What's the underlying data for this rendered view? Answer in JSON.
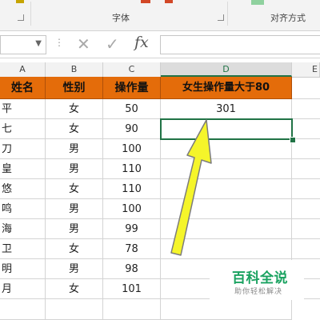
{
  "ribbon": {
    "font_group_label": "字体",
    "align_group_label": "对齐方式"
  },
  "formula_bar": {
    "namebox_value": "",
    "cancel_symbol": "✕",
    "enter_symbol": "✓",
    "fx_label": "fx",
    "formula_value": ""
  },
  "columns": [
    "A",
    "B",
    "C",
    "D",
    "E"
  ],
  "table": {
    "headers": [
      "姓名",
      "性别",
      "操作量",
      "女生操作量大于80"
    ],
    "rows": [
      {
        "name": "平",
        "gender": "女",
        "ops": "50",
        "d": "301"
      },
      {
        "name": "七",
        "gender": "女",
        "ops": "90",
        "d": ""
      },
      {
        "name": "刀",
        "gender": "男",
        "ops": "100",
        "d": ""
      },
      {
        "name": "皇",
        "gender": "男",
        "ops": "110",
        "d": ""
      },
      {
        "name": "悠",
        "gender": "女",
        "ops": "110",
        "d": ""
      },
      {
        "name": "鸣",
        "gender": "男",
        "ops": "100",
        "d": ""
      },
      {
        "name": "海",
        "gender": "男",
        "ops": "99",
        "d": ""
      },
      {
        "name": "卫",
        "gender": "女",
        "ops": "78",
        "d": ""
      },
      {
        "name": "明",
        "gender": "男",
        "ops": "98",
        "d": ""
      },
      {
        "name": "月",
        "gender": "女",
        "ops": "101",
        "d": ""
      }
    ]
  },
  "watermark": {
    "title": "百科全说",
    "subtitle": "助你轻松解决"
  },
  "colors": {
    "header_fill": "#e46c0a",
    "selection": "#217346",
    "arrow": "#f5f52a"
  }
}
